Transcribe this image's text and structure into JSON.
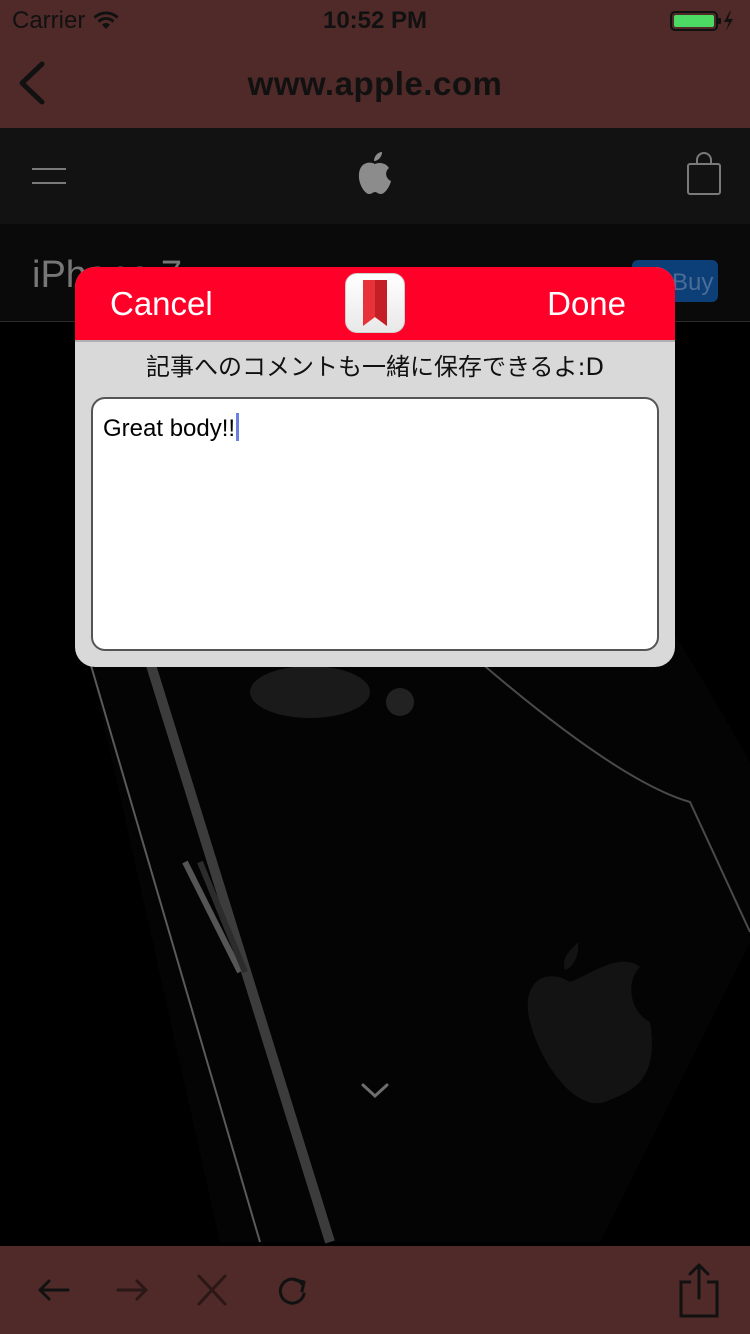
{
  "status_bar": {
    "carrier": "Carrier",
    "time": "10:52 PM",
    "battery_color": "#4cd964"
  },
  "nav_bar": {
    "title": "www.apple.com"
  },
  "web_page": {
    "product_name": "iPhone 7",
    "buy_label": "Buy"
  },
  "dialog": {
    "cancel_label": "Cancel",
    "done_label": "Done",
    "app_icon": "bookmark-ribbon-icon",
    "message": "記事へのコメントも一緒に保存できるよ:D",
    "comment_value": "Great body!!",
    "accent_color": "#ff0028"
  },
  "toolbar": {
    "icons": [
      "back-arrow-icon",
      "forward-arrow-icon",
      "stop-icon",
      "reload-icon",
      "share-icon"
    ]
  },
  "colors": {
    "chrome_background": "#4f2a29",
    "dialog_background": "#d9d9d9"
  }
}
